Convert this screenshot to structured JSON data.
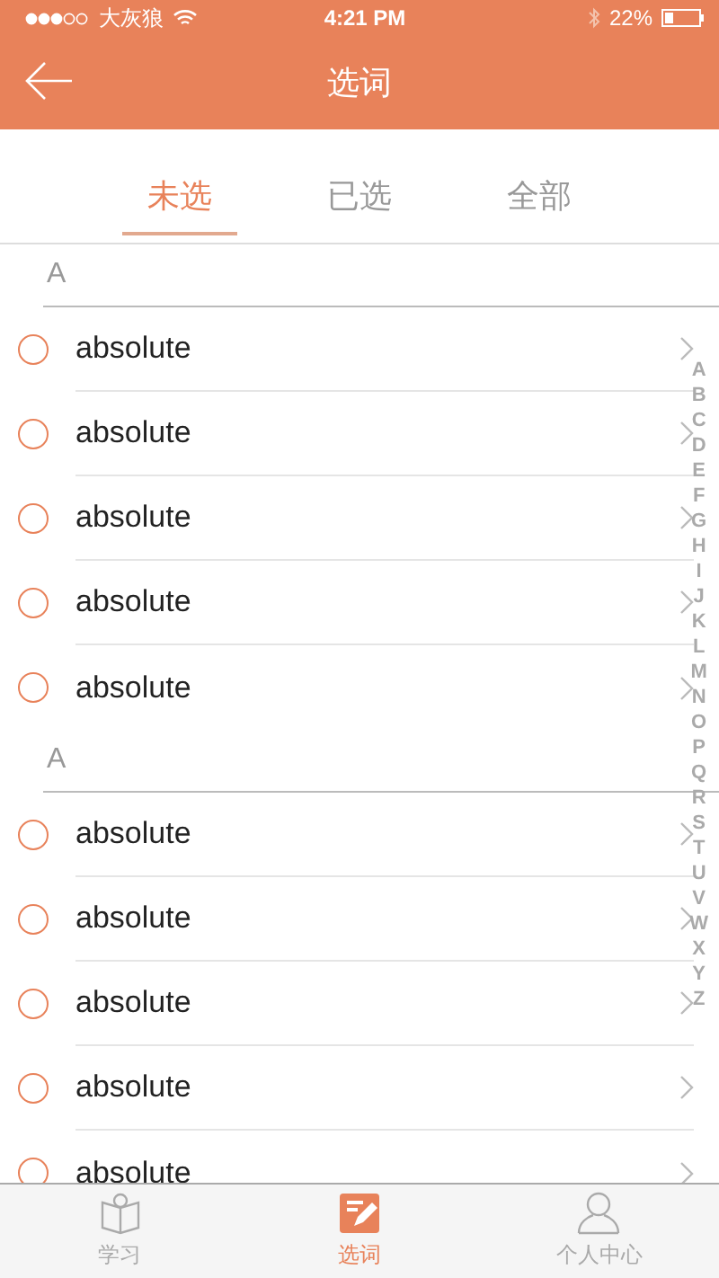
{
  "status_bar": {
    "carrier": "大灰狼",
    "time": "4:21 PM",
    "battery": "22%"
  },
  "nav": {
    "title": "选词"
  },
  "tabs": [
    {
      "label": "未选",
      "selected": true
    },
    {
      "label": "已选",
      "selected": false
    },
    {
      "label": "全部",
      "selected": false
    }
  ],
  "sections": [
    {
      "letter": "A",
      "words": [
        {
          "word": "absolute",
          "selected": false
        },
        {
          "word": "absolute",
          "selected": false
        },
        {
          "word": "absolute",
          "selected": false
        },
        {
          "word": "absolute",
          "selected": false
        },
        {
          "word": "absolute",
          "selected": false
        }
      ]
    },
    {
      "letter": "A",
      "words": [
        {
          "word": "absolute",
          "selected": false
        },
        {
          "word": "absolute",
          "selected": false
        },
        {
          "word": "absolute",
          "selected": false
        },
        {
          "word": "absolute",
          "selected": false
        },
        {
          "word": "absolute",
          "selected": false
        }
      ]
    }
  ],
  "index": [
    "A",
    "B",
    "C",
    "D",
    "E",
    "F",
    "G",
    "H",
    "I",
    "J",
    "K",
    "L",
    "M",
    "N",
    "O",
    "P",
    "Q",
    "R",
    "S",
    "T",
    "U",
    "V",
    "W",
    "X",
    "Y",
    "Z"
  ],
  "tab_bar": [
    {
      "label": "学习",
      "kind": "book",
      "selected": false
    },
    {
      "label": "选词",
      "kind": "note",
      "selected": true
    },
    {
      "label": "个人中心",
      "kind": "person",
      "selected": false
    }
  ]
}
